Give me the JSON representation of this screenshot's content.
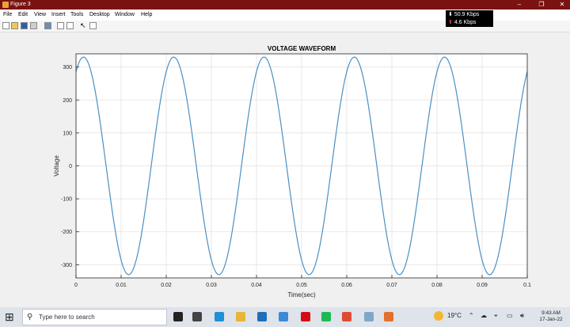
{
  "window": {
    "title": "Figure 3",
    "minimize": "–",
    "maximize": "❐",
    "close": "✕"
  },
  "menu": [
    "File",
    "Edit",
    "View",
    "Insert",
    "Tools",
    "Desktop",
    "Window",
    "Help"
  ],
  "toolbar_icons": [
    "new-figure-icon",
    "open-file-icon",
    "save-icon",
    "print-icon",
    "print-preview-icon",
    "link-plot-icon",
    "insert-colorbar-icon",
    "select-arrow-icon",
    "plot-browser-icon"
  ],
  "netmon": {
    "download": "50.9 Kbps",
    "upload": "4.6 Kbps",
    "download_arrow": "⬇",
    "upload_arrow": "⬆"
  },
  "chart_data": {
    "type": "line",
    "title": "VOLTAGE WAVEFORM",
    "xlabel": "Time(sec)",
    "ylabel": "Voltage",
    "xlim": [
      0,
      0.1
    ],
    "ylim": [
      -340,
      340
    ],
    "xticks": [
      0,
      0.01,
      0.02,
      0.03,
      0.04,
      0.05,
      0.06,
      0.07,
      0.08,
      0.09,
      0.1
    ],
    "xtick_labels": [
      "0",
      "0.01",
      "0.02",
      "0.03",
      "0.04",
      "0.05",
      "0.06",
      "0.07",
      "0.08",
      "0.09",
      "0.1"
    ],
    "yticks": [
      -300,
      -200,
      -100,
      0,
      100,
      200,
      300
    ],
    "grid": true,
    "line_color": "#4a90c2",
    "series": [
      {
        "amplitude": 330,
        "frequency_hz": 50,
        "phase_deg": 60
      }
    ]
  },
  "taskbar": {
    "search_placeholder": "Type here to search",
    "weather": "19°C",
    "time": "9:43 AM",
    "date": "17-Jan-22",
    "start_icon": "⊞",
    "search_icon": "⚲",
    "apps": [
      {
        "name": "cortana-icon",
        "color": "#222222"
      },
      {
        "name": "task-view-icon",
        "color": "#444444"
      },
      {
        "name": "edge-icon",
        "color": "#1f8fd6"
      },
      {
        "name": "file-explorer-icon",
        "color": "#e8b534"
      },
      {
        "name": "store-icon",
        "color": "#1c6fb8"
      },
      {
        "name": "mail-icon",
        "color": "#3a8ad6"
      },
      {
        "name": "netflix-icon",
        "color": "#d40c14"
      },
      {
        "name": "spotify-icon",
        "color": "#1db954"
      },
      {
        "name": "chrome-icon",
        "color": "#e04b34"
      },
      {
        "name": "photos-icon",
        "color": "#7fa7c8"
      },
      {
        "name": "matlab-icon",
        "color": "#e36f2c"
      }
    ]
  }
}
